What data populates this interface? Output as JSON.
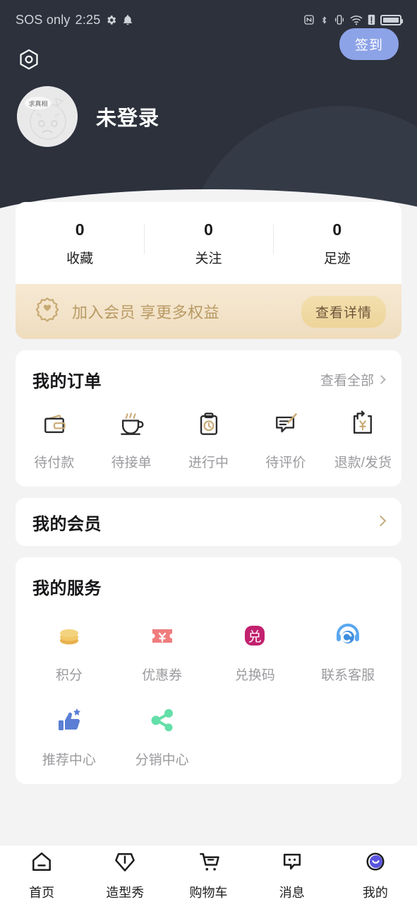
{
  "status_bar": {
    "carrier": "SOS only",
    "time": "2:25",
    "left_icons": [
      "gear-icon",
      "bell-icon"
    ],
    "right_icons": [
      "nfc-icon",
      "bluetooth-icon",
      "vibrate-icon",
      "wifi-icon",
      "sim-alert-icon",
      "battery-icon"
    ]
  },
  "header": {
    "settings_icon": "hexagon-settings-icon",
    "avatar_bubble_text": "求真相",
    "nickname": "未登录",
    "checkin_label": "签到",
    "background_color": "#2c313c",
    "checkin_color": "#8da3e8"
  },
  "stats": [
    {
      "value": "0",
      "label": "收藏"
    },
    {
      "value": "0",
      "label": "关注"
    },
    {
      "value": "0",
      "label": "足迹"
    }
  ],
  "member_banner": {
    "icon": "member-badge-icon",
    "text": "加入会员 享更多权益",
    "button_label": "查看详情",
    "accent_color": "#b99a63"
  },
  "orders": {
    "title": "我的订单",
    "more_label": "查看全部",
    "items": [
      {
        "label": "待付款",
        "icon": "wallet-icon"
      },
      {
        "label": "待接单",
        "icon": "coffee-cup-icon"
      },
      {
        "label": "进行中",
        "icon": "clipboard-clock-icon"
      },
      {
        "label": "待评价",
        "icon": "review-pencil-icon"
      },
      {
        "label": "退款/发货",
        "icon": "refund-yuan-icon"
      }
    ]
  },
  "membership_row": {
    "title": "我的会员",
    "chevron": "chevron-right-icon"
  },
  "services": {
    "title": "我的服务",
    "items": [
      {
        "label": "积分",
        "icon": "coins-icon",
        "color": "#f0c35f"
      },
      {
        "label": "优惠券",
        "icon": "coupon-yuan-icon",
        "color": "#ef7d7d"
      },
      {
        "label": "兑换码",
        "icon": "redeem-code-icon",
        "color": "#c2216e"
      },
      {
        "label": "联系客服",
        "icon": "headset-support-icon",
        "color": "#5aa7f0"
      },
      {
        "label": "推荐中心",
        "icon": "thumbs-up-star-icon",
        "color": "#5b7fd4"
      },
      {
        "label": "分销中心",
        "icon": "share-nodes-icon",
        "color": "#63dfa8"
      }
    ]
  },
  "tabbar": {
    "items": [
      {
        "label": "首页",
        "icon": "home-icon",
        "active": false
      },
      {
        "label": "造型秀",
        "icon": "gem-icon",
        "active": false
      },
      {
        "label": "购物车",
        "icon": "cart-icon",
        "active": false
      },
      {
        "label": "消息",
        "icon": "message-icon",
        "active": false
      },
      {
        "label": "我的",
        "icon": "profile-icon",
        "active": true
      }
    ]
  }
}
